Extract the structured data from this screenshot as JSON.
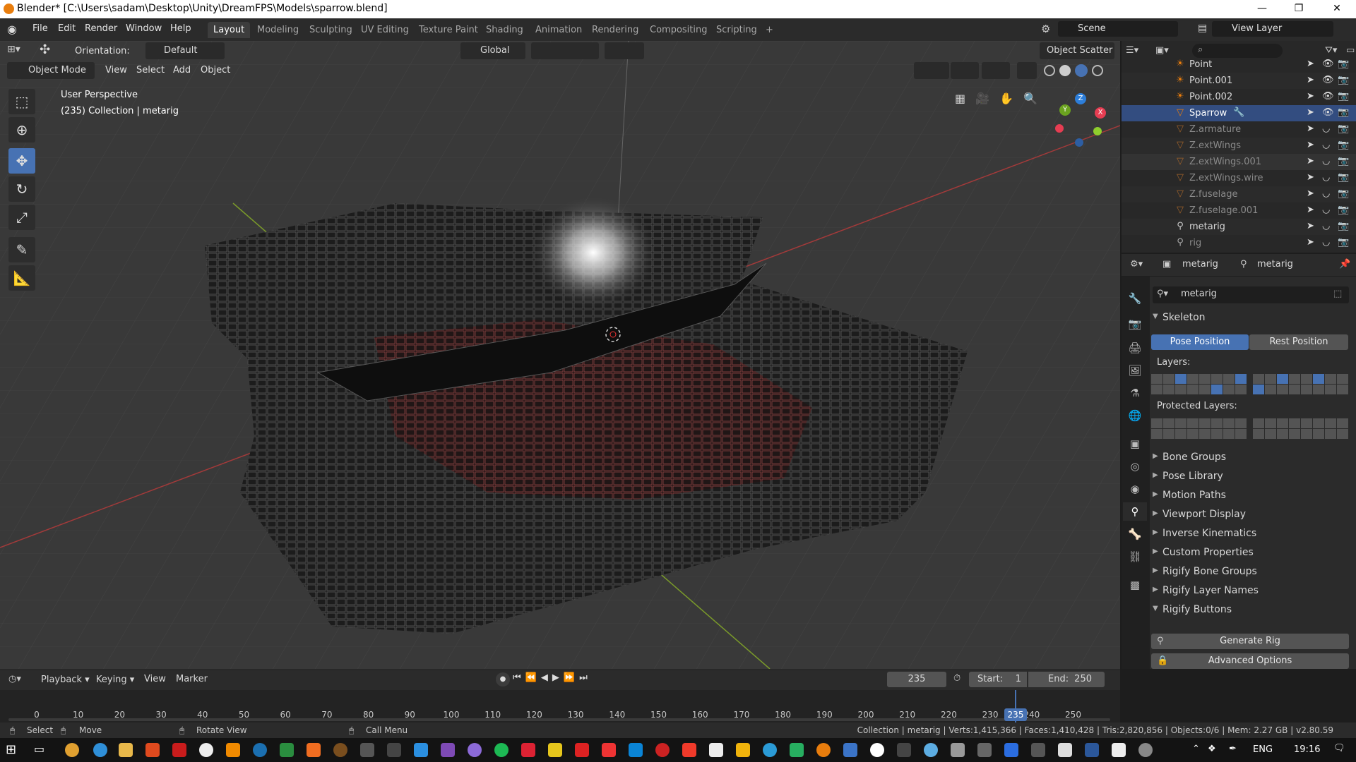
{
  "window": {
    "title": "Blender* [C:\\Users\\sadam\\Desktop\\Unity\\DreamFPS\\Models\\sparrow.blend]",
    "minimize": "—",
    "maximize": "❐",
    "close": "✕"
  },
  "menu": {
    "items": [
      "File",
      "Edit",
      "Render",
      "Window",
      "Help"
    ],
    "workspaces": [
      "Layout",
      "Modeling",
      "Sculpting",
      "UV Editing",
      "Texture Paint",
      "Shading",
      "Animation",
      "Rendering",
      "Compositing",
      "Scripting",
      "+"
    ],
    "active_workspace": "Layout",
    "scene": "Scene",
    "view_layer": "View Layer"
  },
  "viewport": {
    "orientation_label": "Orientation:",
    "orientation_value": "Default",
    "transform_space": "Global",
    "mode": "Object Mode",
    "view_menu": [
      "View",
      "Select",
      "Add",
      "Object"
    ],
    "object_scatter": "Object Scatter",
    "perspective_label": "User Perspective",
    "collection_info": "(235) Collection | metarig",
    "gizmo": {
      "x": "X",
      "y": "Y",
      "z": "Z"
    }
  },
  "outliner": {
    "rows": [
      {
        "name": "Point",
        "icon": "light-icon",
        "type": "light",
        "selected": false
      },
      {
        "name": "Point.001",
        "icon": "light-icon",
        "type": "light",
        "selected": false
      },
      {
        "name": "Point.002",
        "icon": "light-icon",
        "type": "light",
        "selected": false
      },
      {
        "name": "Sparrow",
        "icon": "mesh-icon",
        "type": "mesh",
        "selected": true
      },
      {
        "name": "Z.armature",
        "icon": "mesh-icon",
        "type": "mesh-dim",
        "selected": false
      },
      {
        "name": "Z.extWings",
        "icon": "mesh-icon",
        "type": "mesh-dim",
        "selected": false
      },
      {
        "name": "Z.extWings.001",
        "icon": "mesh-icon",
        "type": "mesh-dim",
        "selected": false
      },
      {
        "name": "Z.extWings.wire",
        "icon": "mesh-icon",
        "type": "mesh-dim",
        "selected": false
      },
      {
        "name": "Z.fuselage",
        "icon": "mesh-icon",
        "type": "mesh-dim",
        "selected": false
      },
      {
        "name": "Z.fuselage.001",
        "icon": "mesh-icon",
        "type": "mesh-dim",
        "selected": false
      },
      {
        "name": "metarig",
        "icon": "armature-icon",
        "type": "armature",
        "selected": false
      },
      {
        "name": "rig",
        "icon": "armature-icon",
        "type": "armature-dim",
        "selected": false
      }
    ]
  },
  "properties": {
    "breadcrumb_object": "metarig",
    "breadcrumb_data": "metarig",
    "data_name": "metarig",
    "skeleton_label": "Skeleton",
    "pose_position": "Pose Position",
    "rest_position": "Rest Position",
    "layers_label": "Layers:",
    "protected_layers_label": "Protected Layers:",
    "sections": [
      "Bone Groups",
      "Pose Library",
      "Motion Paths",
      "Viewport Display",
      "Inverse Kinematics",
      "Custom Properties",
      "Rigify Bone Groups",
      "Rigify Layer Names",
      "Rigify Buttons"
    ],
    "generate_rig": "Generate Rig",
    "advanced_options": "Advanced Options"
  },
  "timeline": {
    "menus": [
      "Playback",
      "Keying",
      "View",
      "Marker"
    ],
    "current_frame": "235",
    "start_label": "Start:",
    "start_value": "1",
    "end_label": "End:",
    "end_value": "250",
    "ticks": [
      "0",
      "10",
      "20",
      "30",
      "40",
      "50",
      "60",
      "70",
      "80",
      "90",
      "100",
      "110",
      "120",
      "130",
      "140",
      "150",
      "160",
      "170",
      "180",
      "190",
      "200",
      "210",
      "220",
      "230",
      "240",
      "250"
    ],
    "playhead_label": "235"
  },
  "status": {
    "select": "Select",
    "move": "Move",
    "rotate": "Rotate View",
    "call_menu": "Call Menu",
    "stats": "Collection | metarig | Verts:1,415,366 | Faces:1,410,428 | Tris:2,820,856 | Objects:0/6 | Mem: 2.27 GB | v2.80.59"
  },
  "taskbar": {
    "lang": "ENG",
    "time": "19:16"
  },
  "colors": {
    "accent": "#4772b3",
    "selected_row": "#334d80",
    "light_icon": "#e87d0d",
    "gizmo_x": "#e63d52",
    "gizmo_y": "#6ba31f",
    "gizmo_z": "#2d7ed9"
  }
}
